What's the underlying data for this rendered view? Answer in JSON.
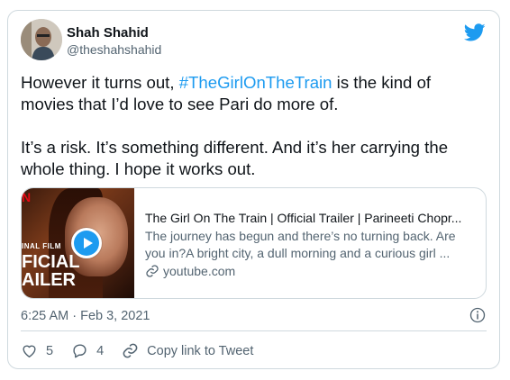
{
  "author": {
    "name": "Shah Shahid",
    "handle": "@theshahshahid"
  },
  "tweet": {
    "line1_before": "However it turns out, ",
    "hashtag": "#TheGirlOnTheTrain",
    "line1_after": " is the kind of movies that I’d love to see Pari do more of.",
    "paragraph2": "It’s a risk. It’s something different. And it’s her carrying the whole thing. I hope it works out."
  },
  "link_card": {
    "title": "The Girl On The Train | Official Trailer | Parineeti Chopr...",
    "description_line1": "The journey has begun and there’s no turning back. Are",
    "description_line2": "you in?A bright city, a dull morning and a curious girl ...",
    "domain": "youtube.com",
    "thumb_text_netflix": "N",
    "thumb_text_original": "INAL FILM",
    "thumb_text_official": "FICIAL",
    "thumb_text_trailer": "AILER"
  },
  "timestamp": "6:25 AM · Feb 3, 2021",
  "actions": {
    "likes": "5",
    "replies": "4",
    "copy_link": "Copy link to Tweet"
  },
  "colors": {
    "accent": "#1d9bf0",
    "text": "#0f1419",
    "muted": "#536471",
    "border": "#cfd9de"
  }
}
